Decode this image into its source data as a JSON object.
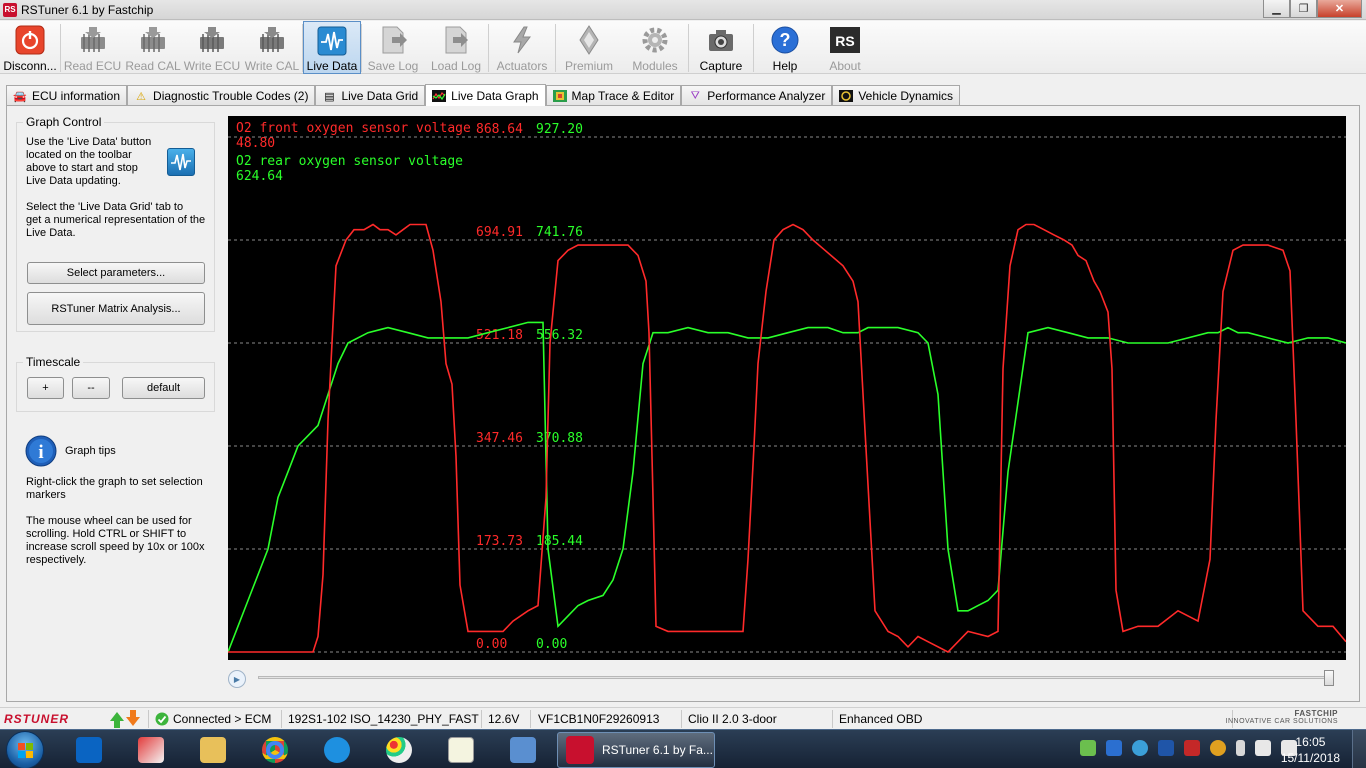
{
  "window": {
    "title": "RSTuner 6.1 by Fastchip",
    "icon_text": "RS"
  },
  "toolbar": [
    {
      "label": "Disconn...",
      "icon": "power-icon",
      "disabled": false
    },
    {
      "label": "Read ECU",
      "icon": "chip-read-icon",
      "disabled": true
    },
    {
      "label": "Read CAL",
      "icon": "chip-read-icon",
      "disabled": true
    },
    {
      "label": "Write ECU",
      "icon": "chip-write-icon",
      "disabled": true
    },
    {
      "label": "Write CAL",
      "icon": "chip-write-icon",
      "disabled": true
    },
    {
      "label": "Live Data",
      "icon": "live-data-icon",
      "disabled": false,
      "active": true
    },
    {
      "label": "Save Log",
      "icon": "save-log-icon",
      "disabled": true
    },
    {
      "label": "Load Log",
      "icon": "load-log-icon",
      "disabled": true
    },
    {
      "label": "Actuators",
      "icon": "actuator-icon",
      "disabled": true
    },
    {
      "label": "Premium",
      "icon": "renault-icon",
      "disabled": true
    },
    {
      "label": "Modules",
      "icon": "gear-icon",
      "disabled": true
    },
    {
      "label": "Capture",
      "icon": "camera-icon",
      "disabled": false
    },
    {
      "label": "Help",
      "icon": "help-icon",
      "disabled": false
    },
    {
      "label": "About",
      "icon": "rs-logo-icon",
      "disabled": true
    }
  ],
  "tabs": [
    {
      "label": "ECU information",
      "icon": "car-icon"
    },
    {
      "label": "Diagnostic Trouble Codes (2)",
      "icon": "warning-icon"
    },
    {
      "label": "Live Data Grid",
      "icon": "grid-icon"
    },
    {
      "label": "Live Data Graph",
      "icon": "graph-icon",
      "active": true
    },
    {
      "label": "Map Trace & Editor",
      "icon": "map-icon"
    },
    {
      "label": "Performance Analyzer",
      "icon": "performance-icon"
    },
    {
      "label": "Vehicle Dynamics",
      "icon": "dynamics-icon"
    }
  ],
  "graph_control": {
    "title": "Graph Control",
    "text1": [
      "Use the 'Live Data' button",
      "located on the toolbar",
      "above to start and stop",
      "Live Data updating."
    ],
    "text2": [
      "Select the 'Live Data Grid' tab to",
      "get a numerical representation of the",
      "Live Data."
    ],
    "select_btn": "Select parameters...",
    "matrix_btn": "RSTuner Matrix Analysis..."
  },
  "timescale": {
    "title": "Timescale",
    "plus": "+",
    "minus": "--",
    "default": "default"
  },
  "graph_tips": {
    "title": "Graph tips",
    "text1": [
      "Right-click the graph to set selection",
      "markers"
    ],
    "text2": [
      "The mouse wheel can be used for",
      "scrolling. Hold CTRL or SHIFT to",
      "increase scroll speed by 10x or 100x",
      "respectively."
    ]
  },
  "chart_data": {
    "type": "line",
    "background": "#000000",
    "series": [
      {
        "name": "O2 front oxygen sensor voltage",
        "current_value": "48.80",
        "color": "#ff2a2a",
        "axis_labels": [
          "868.64",
          "694.91",
          "521.18",
          "347.46",
          "173.73",
          "0.00"
        ]
      },
      {
        "name": "O2 rear oxygen sensor voltage",
        "current_value": "624.64",
        "color": "#2aff2a",
        "axis_labels": [
          "927.20",
          "741.76",
          "556.32",
          "370.88",
          "185.44",
          "0.00"
        ]
      }
    ],
    "front_range": [
      0,
      868.64
    ],
    "rear_range": [
      0,
      927.2
    ],
    "gridlines": 6,
    "front_samples": [
      [
        0,
        0.0
      ],
      [
        10,
        0.0
      ],
      [
        30,
        0.0
      ],
      [
        45,
        0.0
      ],
      [
        60,
        0.0
      ],
      [
        75,
        0.0
      ],
      [
        85,
        0.0
      ],
      [
        90,
        0.3
      ],
      [
        95,
        1.5
      ],
      [
        100,
        4.5
      ],
      [
        108,
        7.5
      ],
      [
        118,
        8.0
      ],
      [
        126,
        8.2
      ],
      [
        136,
        8.2
      ],
      [
        145,
        8.3
      ],
      [
        152,
        8.2
      ],
      [
        160,
        8.2
      ],
      [
        168,
        8.1
      ],
      [
        175,
        8.2
      ],
      [
        182,
        8.3
      ],
      [
        190,
        8.3
      ],
      [
        198,
        8.3
      ],
      [
        205,
        7.8
      ],
      [
        213,
        6.8
      ],
      [
        218,
        5.6
      ],
      [
        224,
        5.2
      ],
      [
        228,
        3.8
      ],
      [
        232,
        1.3
      ],
      [
        240,
        0.4
      ],
      [
        260,
        0.4
      ],
      [
        275,
        0.4
      ],
      [
        285,
        0.6
      ],
      [
        300,
        0.8
      ],
      [
        310,
        0.9
      ],
      [
        318,
        3.0
      ],
      [
        322,
        6.0
      ],
      [
        330,
        7.6
      ],
      [
        340,
        7.8
      ],
      [
        350,
        7.9
      ],
      [
        360,
        7.9
      ],
      [
        370,
        7.9
      ],
      [
        385,
        7.9
      ],
      [
        400,
        7.9
      ],
      [
        410,
        7.7
      ],
      [
        418,
        7.2
      ],
      [
        421,
        6.2
      ],
      [
        425,
        3.0
      ],
      [
        428,
        0.5
      ],
      [
        440,
        0.4
      ],
      [
        460,
        0.4
      ],
      [
        480,
        0.4
      ],
      [
        500,
        0.4
      ],
      [
        515,
        0.4
      ],
      [
        520,
        1.8
      ],
      [
        526,
        4.0
      ],
      [
        530,
        5.6
      ],
      [
        538,
        7.0
      ],
      [
        546,
        8.0
      ],
      [
        555,
        8.2
      ],
      [
        565,
        8.3
      ],
      [
        575,
        8.2
      ],
      [
        585,
        8.0
      ],
      [
        597,
        7.8
      ],
      [
        615,
        7.5
      ],
      [
        625,
        7.2
      ],
      [
        630,
        6.8
      ],
      [
        637,
        4.3
      ],
      [
        643,
        2.2
      ],
      [
        647,
        0.8
      ],
      [
        660,
        0.4
      ],
      [
        670,
        0.3
      ],
      [
        675,
        0.2
      ],
      [
        680,
        0.1
      ],
      [
        690,
        0.3
      ],
      [
        700,
        0.2
      ],
      [
        720,
        0.0
      ],
      [
        740,
        0.4
      ],
      [
        760,
        0.3
      ],
      [
        770,
        0.4
      ],
      [
        775,
        5.5
      ],
      [
        782,
        7.5
      ],
      [
        790,
        8.2
      ],
      [
        798,
        8.3
      ],
      [
        806,
        8.3
      ],
      [
        816,
        8.2
      ],
      [
        826,
        8.1
      ],
      [
        836,
        8.0
      ],
      [
        844,
        7.9
      ],
      [
        850,
        7.7
      ],
      [
        858,
        7.6
      ],
      [
        866,
        7.2
      ],
      [
        872,
        7.0
      ],
      [
        880,
        6.6
      ],
      [
        884,
        5.5
      ],
      [
        888,
        1.2
      ],
      [
        895,
        0.4
      ],
      [
        910,
        0.5
      ],
      [
        930,
        0.5
      ],
      [
        950,
        0.8
      ],
      [
        970,
        0.6
      ],
      [
        982,
        1.8
      ],
      [
        988,
        4.5
      ],
      [
        995,
        7.0
      ],
      [
        1005,
        7.8
      ],
      [
        1015,
        7.9
      ],
      [
        1025,
        7.9
      ],
      [
        1040,
        7.9
      ],
      [
        1055,
        7.8
      ],
      [
        1062,
        7.4
      ],
      [
        1068,
        4.5
      ],
      [
        1075,
        0.8
      ],
      [
        1090,
        0.5
      ],
      [
        1105,
        0.5
      ],
      [
        1118,
        0.2
      ]
    ],
    "rear_samples": [
      [
        0,
        0.0
      ],
      [
        20,
        1.0
      ],
      [
        40,
        2.0
      ],
      [
        50,
        3.0
      ],
      [
        60,
        3.5
      ],
      [
        70,
        4.0
      ],
      [
        80,
        4.2
      ],
      [
        90,
        4.4
      ],
      [
        100,
        5.0
      ],
      [
        110,
        5.6
      ],
      [
        120,
        6.0
      ],
      [
        140,
        6.2
      ],
      [
        160,
        6.3
      ],
      [
        180,
        6.2
      ],
      [
        200,
        6.1
      ],
      [
        220,
        6.1
      ],
      [
        240,
        6.1
      ],
      [
        260,
        6.2
      ],
      [
        280,
        6.3
      ],
      [
        300,
        6.4
      ],
      [
        315,
        6.4
      ],
      [
        320,
        2.0
      ],
      [
        330,
        0.5
      ],
      [
        340,
        0.7
      ],
      [
        350,
        0.9
      ],
      [
        360,
        1.0
      ],
      [
        375,
        1.1
      ],
      [
        385,
        1.4
      ],
      [
        395,
        2.0
      ],
      [
        405,
        3.5
      ],
      [
        415,
        5.6
      ],
      [
        425,
        6.2
      ],
      [
        440,
        6.2
      ],
      [
        460,
        6.3
      ],
      [
        480,
        6.2
      ],
      [
        500,
        6.2
      ],
      [
        520,
        6.1
      ],
      [
        540,
        6.1
      ],
      [
        560,
        6.2
      ],
      [
        580,
        6.3
      ],
      [
        600,
        6.3
      ],
      [
        615,
        6.2
      ],
      [
        630,
        6.2
      ],
      [
        640,
        6.3
      ],
      [
        650,
        6.3
      ],
      [
        670,
        6.3
      ],
      [
        690,
        6.2
      ],
      [
        700,
        6.0
      ],
      [
        710,
        5.0
      ],
      [
        720,
        2.0
      ],
      [
        730,
        0.8
      ],
      [
        740,
        0.8
      ],
      [
        750,
        0.9
      ],
      [
        760,
        1.0
      ],
      [
        770,
        1.2
      ],
      [
        780,
        3.5
      ],
      [
        800,
        6.2
      ],
      [
        820,
        6.3
      ],
      [
        840,
        6.2
      ],
      [
        860,
        6.1
      ],
      [
        880,
        6.1
      ],
      [
        900,
        6.0
      ],
      [
        920,
        6.0
      ],
      [
        940,
        6.0
      ],
      [
        960,
        6.1
      ],
      [
        980,
        6.2
      ],
      [
        990,
        6.2
      ],
      [
        1000,
        6.3
      ],
      [
        1010,
        6.2
      ],
      [
        1020,
        6.2
      ],
      [
        1040,
        6.1
      ],
      [
        1060,
        6.0
      ],
      [
        1080,
        6.1
      ],
      [
        1100,
        6.1
      ],
      [
        1118,
        6.0
      ]
    ]
  },
  "statusbar": {
    "logo": "RSTUNER",
    "connected": "Connected > ECM",
    "ecu": "192S1-102",
    "protocol": "ISO_14230_PHY_FAST",
    "voltage": "12.6V",
    "vin": "VF1CB1N0F29260913",
    "vehicle": "Clio II 2.0 3-door",
    "mode": "Enhanced OBD",
    "brand": "FASTCHIP",
    "brand_sub": "INNOVATIVE CAR SOLUTIONS"
  },
  "taskbar": {
    "running_app": "RSTuner 6.1 by Fa...",
    "time": "16:05",
    "date": "15/11/2018",
    "pinned": [
      "outlook-icon",
      "paint-tool-icon",
      "explorer-icon",
      "chrome-icon",
      "ie-icon",
      "paint-icon",
      "editor-icon",
      "network-icon"
    ]
  }
}
